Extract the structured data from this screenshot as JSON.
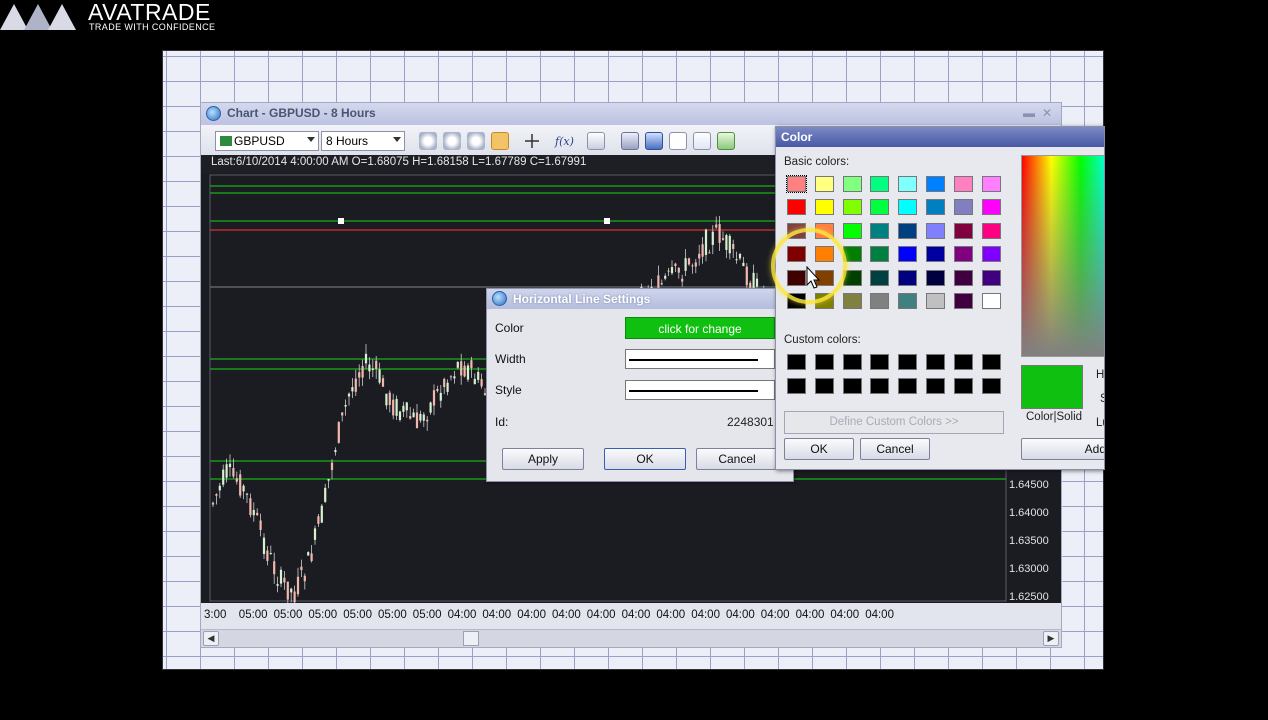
{
  "brand": {
    "name": "AVATRADE",
    "tagline": "TRADE WITH CONFIDENCE"
  },
  "chart_window": {
    "title": "Chart - GBPUSD - 8 Hours",
    "symbol": "GBPUSD",
    "timeframe": "8 Hours",
    "info": "Last:6/10/2014 4:00:00 AM O=1.68075 H=1.68158 L=1.67789 C=1.67991",
    "time_labels": [
      "3:00",
      "05:00",
      "05:00",
      "05:00",
      "05:00",
      "05:00",
      "05:00",
      "04:00",
      "04:00",
      "04:00",
      "04:00",
      "04:00",
      "04:00",
      "04:00",
      "04:00",
      "04:00",
      "04:00",
      "04:00",
      "04:00",
      "04:00"
    ],
    "price_labels": [
      "1.64500",
      "1.64000",
      "1.63500",
      "1.63000",
      "1.62500"
    ]
  },
  "hl_dialog": {
    "title": "Horizontal Line Settings",
    "color_label": "Color",
    "color_button": "click for change",
    "width_label": "Width",
    "style_label": "Style",
    "id_label": "Id:",
    "id_value": "2248301",
    "apply": "Apply",
    "ok": "OK",
    "cancel": "Cancel",
    "selected_color": "#10c010"
  },
  "color_dialog": {
    "title": "Color",
    "basic_colors_label": "Basic colors:",
    "custom_colors_label": "Custom colors:",
    "define_custom": "Define Custom Colors >>",
    "preview_label": "Color|Solid",
    "ok": "OK",
    "cancel": "Cancel",
    "add": "Add",
    "side_labels": [
      "H",
      "S",
      "Lu"
    ],
    "basic_colors": [
      [
        "#ff8080",
        "#ffff80",
        "#80ff80",
        "#00ff80",
        "#80ffff",
        "#0080ff",
        "#ff80c0",
        "#ff80ff"
      ],
      [
        "#ff0000",
        "#ffff00",
        "#80ff00",
        "#00ff40",
        "#00ffff",
        "#0080c0",
        "#8080c0",
        "#ff00ff"
      ],
      [
        "#804040",
        "#ff8040",
        "#00ff00",
        "#008080",
        "#004080",
        "#8080ff",
        "#800040",
        "#ff0080"
      ],
      [
        "#800000",
        "#ff8000",
        "#008000",
        "#008040",
        "#0000ff",
        "#0000a0",
        "#800080",
        "#8000ff"
      ],
      [
        "#400000",
        "#804000",
        "#004000",
        "#004040",
        "#000080",
        "#000040",
        "#400040",
        "#400080"
      ],
      [
        "#000000",
        "#808000",
        "#808040",
        "#808080",
        "#408080",
        "#c0c0c0",
        "#400040",
        "#ffffff"
      ]
    ]
  }
}
